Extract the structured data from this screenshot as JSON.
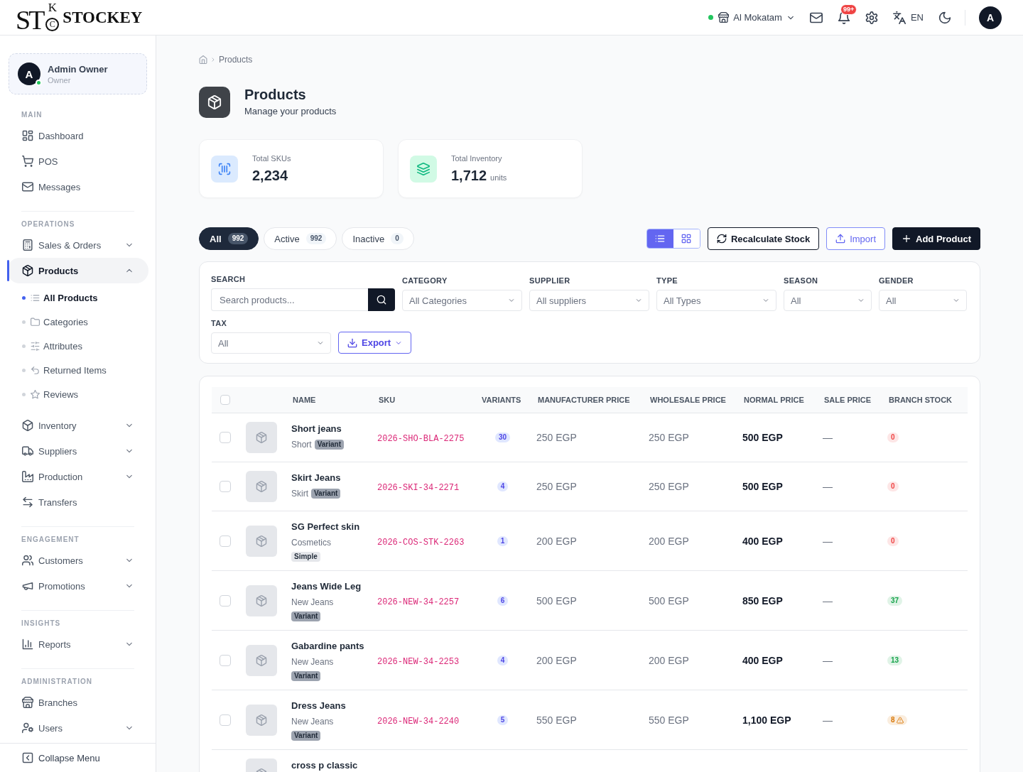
{
  "topbar": {
    "logo": {
      "mark": [
        "S",
        "T",
        "K",
        "C"
      ],
      "name": "STOCKEY"
    },
    "branch": {
      "name": "Al Mokatam",
      "online": true
    },
    "notifications": {
      "count": "99+"
    },
    "language": "EN",
    "avatar": "A"
  },
  "sidebar": {
    "profile": {
      "initial": "A",
      "name": "Admin Owner",
      "role": "Owner",
      "online": true
    },
    "sections": [
      {
        "title": "MAIN",
        "items": [
          {
            "label": "Dashboard",
            "selected": false
          },
          {
            "label": "POS",
            "selected": false
          },
          {
            "label": "Messages",
            "selected": false
          }
        ]
      },
      {
        "title": "OPERATIONS",
        "items": [
          {
            "label": "Sales & Orders",
            "selected": false,
            "expanded": false
          },
          {
            "label": "Products",
            "selected": true,
            "expanded": true,
            "children": [
              {
                "label": "All Products",
                "selected": true
              },
              {
                "label": "Categories",
                "selected": false
              },
              {
                "label": "Attributes",
                "selected": false
              },
              {
                "label": "Returned Items",
                "selected": false
              },
              {
                "label": "Reviews",
                "selected": false
              }
            ]
          },
          {
            "label": "Inventory",
            "selected": false,
            "expanded": false
          },
          {
            "label": "Suppliers",
            "selected": false,
            "expanded": false
          },
          {
            "label": "Production",
            "selected": false,
            "expanded": false
          },
          {
            "label": "Transfers",
            "selected": false
          }
        ]
      },
      {
        "title": "ENGAGEMENT",
        "items": [
          {
            "label": "Customers",
            "selected": false,
            "expanded": false
          },
          {
            "label": "Promotions",
            "selected": false,
            "expanded": false
          }
        ]
      },
      {
        "title": "INSIGHTS",
        "items": [
          {
            "label": "Reports",
            "selected": false,
            "expanded": false
          }
        ]
      },
      {
        "title": "ADMINISTRATION",
        "items": [
          {
            "label": "Branches",
            "selected": false
          },
          {
            "label": "Users",
            "selected": false,
            "expanded": false
          }
        ]
      }
    ],
    "footer": {
      "label": "Collapse Menu"
    }
  },
  "page": {
    "breadcrumb": "Products",
    "title": "Products",
    "subtitle": "Manage your products"
  },
  "stats": [
    {
      "label": "Total SKUs",
      "value": "2,234"
    },
    {
      "label": "Total Inventory",
      "value": "1,712",
      "unit": "units"
    }
  ],
  "status_tabs": [
    {
      "label": "All",
      "count": "992",
      "selected": true
    },
    {
      "label": "Active",
      "count": "992",
      "selected": false
    },
    {
      "label": "Inactive",
      "count": "0",
      "selected": false
    }
  ],
  "view_toggle": [
    {
      "selected": true
    },
    {
      "selected": false
    }
  ],
  "actions": [
    {
      "label": "Recalculate Stock",
      "kind": "outline"
    },
    {
      "label": "Import",
      "kind": "accent"
    },
    {
      "label": "Add Product",
      "kind": "primary"
    }
  ],
  "filters": {
    "search": {
      "label": "SEARCH",
      "placeholder": "Search products..."
    },
    "selects": [
      {
        "label": "CATEGORY",
        "value": "All Categories"
      },
      {
        "label": "SUPPLIER",
        "value": "All suppliers"
      },
      {
        "label": "TYPE",
        "value": "All Types"
      },
      {
        "label": "SEASON",
        "value": "All"
      },
      {
        "label": "GENDER",
        "value": "All"
      },
      {
        "label": "TAX",
        "value": "All"
      }
    ],
    "export": {
      "label": "Export"
    }
  },
  "table": {
    "select_all": {
      "checked": false
    },
    "columns": [
      "NAME",
      "SKU",
      "VARIANTS",
      "MANUFACTURER PRICE",
      "WHOLESALE PRICE",
      "NORMAL PRICE",
      "SALE PRICE",
      "BRANCH STOCK"
    ],
    "rows": [
      {
        "checked": false,
        "name": "Short jeans",
        "category": "Short",
        "type": "Variant",
        "kind": "variant",
        "sku": "2026-SHO-BLA-2275",
        "variants": "30",
        "manufacturer_price": "250 EGP",
        "wholesale_price": "250 EGP",
        "normal_price": "500 EGP",
        "sale_price": "—",
        "stock": {
          "count": "0",
          "color": "#ef4444",
          "warning": false
        }
      },
      {
        "checked": false,
        "name": "Skirt Jeans",
        "category": "Skirt",
        "type": "Variant",
        "kind": "variant",
        "sku": "2026-SKI-34-2271",
        "variants": "4",
        "manufacturer_price": "250 EGP",
        "wholesale_price": "250 EGP",
        "normal_price": "500 EGP",
        "sale_price": "—",
        "stock": {
          "count": "0",
          "color": "#ef4444",
          "warning": false
        }
      },
      {
        "checked": false,
        "name": "SG Perfect skin",
        "category": "Cosmetics",
        "type": "Simple",
        "kind": "simple",
        "sku": "2026-COS-STK-2263",
        "variants": "1",
        "manufacturer_price": "200 EGP",
        "wholesale_price": "200 EGP",
        "normal_price": "400 EGP",
        "sale_price": "—",
        "stock": {
          "count": "0",
          "color": "#ef4444",
          "warning": false
        }
      },
      {
        "checked": false,
        "name": "Jeans Wide Leg",
        "category": "New Jeans",
        "type": "Variant",
        "kind": "variant",
        "sku": "2026-NEW-34-2257",
        "variants": "6",
        "manufacturer_price": "500 EGP",
        "wholesale_price": "500 EGP",
        "normal_price": "850 EGP",
        "sale_price": "—",
        "stock": {
          "count": "37",
          "color": "#16a34a",
          "warning": false
        }
      },
      {
        "checked": false,
        "name": "Gabardine pants",
        "category": "New Jeans",
        "type": "Variant",
        "kind": "variant",
        "sku": "2026-NEW-34-2253",
        "variants": "4",
        "manufacturer_price": "200 EGP",
        "wholesale_price": "200 EGP",
        "normal_price": "400 EGP",
        "sale_price": "—",
        "stock": {
          "count": "13",
          "color": "#16a34a",
          "warning": false
        }
      },
      {
        "checked": false,
        "name": "Dress Jeans",
        "category": "New Jeans",
        "type": "Variant",
        "kind": "variant",
        "sku": "2026-NEW-34-2240",
        "variants": "5",
        "manufacturer_price": "550 EGP",
        "wholesale_price": "550 EGP",
        "normal_price": "1,100 EGP",
        "sale_price": "—",
        "stock": {
          "count": "8",
          "color": "#d97706",
          "warning": true
        }
      },
      {
        "name": "cross p classic"
      }
    ]
  }
}
